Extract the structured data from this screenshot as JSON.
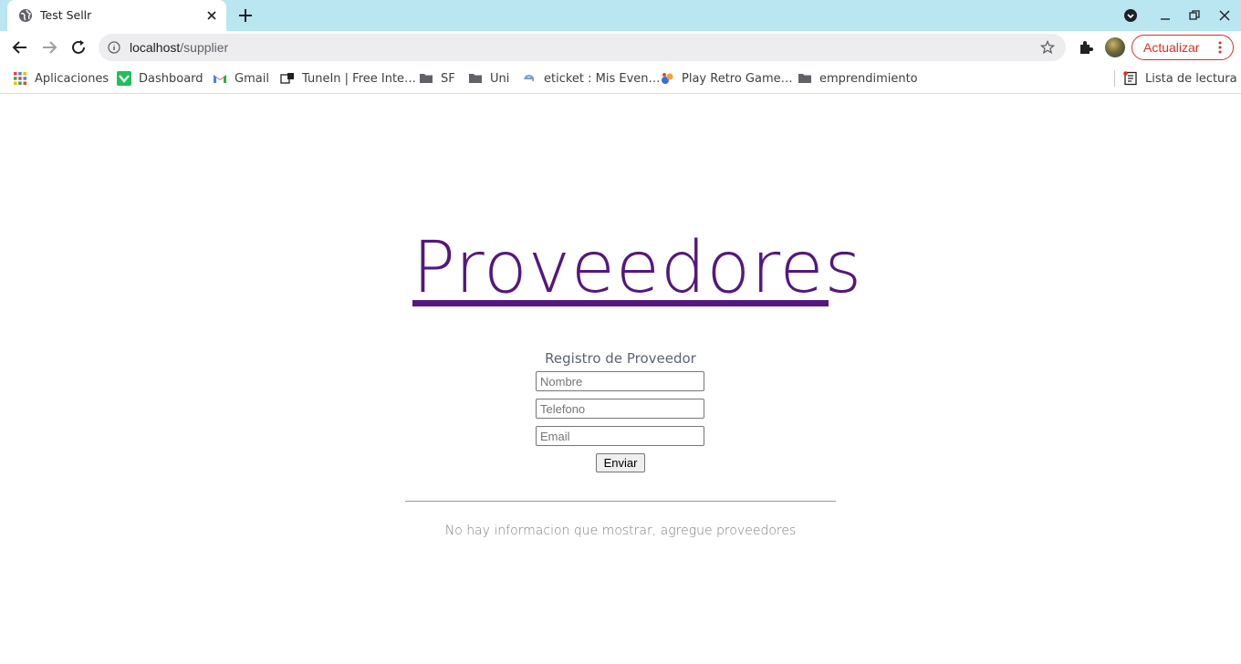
{
  "browser": {
    "tab": {
      "title": "Test Sellr"
    },
    "address_bar": {
      "host": "localhost",
      "path": "/supplier"
    },
    "update_button_label": "Actualizar",
    "bookmarks": [
      {
        "label": "Aplicaciones",
        "icon": "apps-grid-icon"
      },
      {
        "label": "Dashboard",
        "icon": "dashboard-favicon"
      },
      {
        "label": "Gmail",
        "icon": "gmail-icon"
      },
      {
        "label": "TuneIn | Free Inte…",
        "icon": "tunein-icon"
      },
      {
        "label": "SF",
        "icon": "folder-icon"
      },
      {
        "label": "Uni",
        "icon": "folder-icon"
      },
      {
        "label": "eticket : Mis Even…",
        "icon": "eticket-icon"
      },
      {
        "label": "Play Retro Game…",
        "icon": "retro-game-icon"
      },
      {
        "label": "emprendimiento",
        "icon": "folder-icon"
      }
    ],
    "reading_list_label": "Lista de lectura"
  },
  "page": {
    "heading": "Proveedores",
    "form": {
      "title": "Registro de Proveedor",
      "name_placeholder": "Nombre",
      "phone_placeholder": "Telefono",
      "email_placeholder": "Email",
      "submit_label": "Enviar"
    },
    "empty_message": "No hay informacion que mostrar, agregue proveedores"
  },
  "colors": {
    "tabstrip": "#b9e6f1",
    "heading": "#54187f",
    "update_button": "#d93025"
  }
}
